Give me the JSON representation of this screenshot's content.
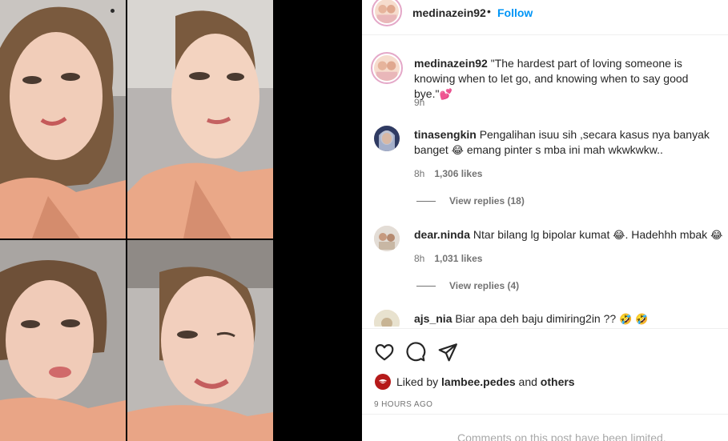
{
  "post": {
    "username": "medinazein92",
    "separator": "•",
    "follow_label": "Follow",
    "caption_user": "medinazein92",
    "caption_text": "\"The hardest part of loving someone is knowing when to let go, and knowing when to say good bye.\"",
    "caption_emoji": "💕",
    "caption_time": "9h"
  },
  "comments": [
    {
      "user": "tinasengkin",
      "text_before": "Pengalihan isuu sih ,secara kasus nya banyak banget",
      "emoji": "😂",
      "text_after": "emang pinter s mba ini mah wkwkwkw..",
      "time": "8h",
      "likes": "1,306 likes",
      "replies": "View replies (18)"
    },
    {
      "user": "dear.ninda",
      "text_before": "Ntar bilang lg bipolar kumat",
      "emoji": "😂",
      "text_after": ". Hadehhh mbak",
      "emoji_end": "😂",
      "time": "8h",
      "likes": "1,031 likes",
      "replies": "View replies (4)"
    },
    {
      "user": "ajs_nia",
      "text_before": "Biar apa deh baju dimiring2in ??",
      "emoji": "🤣 🤣"
    }
  ],
  "actions": {
    "like_icon": "heart-outline-icon",
    "comment_icon": "speech-bubble-icon",
    "share_icon": "paper-plane-icon"
  },
  "likes_summary": {
    "prefix": "Liked by",
    "user": "lambee.pedes",
    "mid": "and",
    "others": "others"
  },
  "time_ago": "9 HOURS AGO",
  "comments_limited": "Comments on this post have been limited."
}
